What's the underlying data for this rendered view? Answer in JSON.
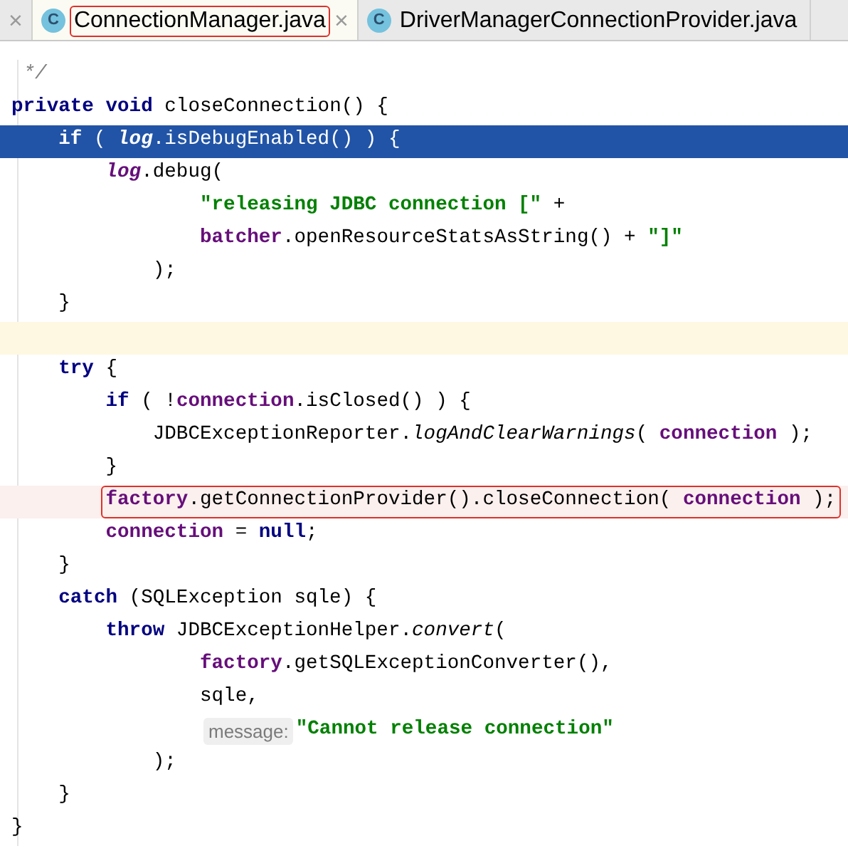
{
  "tabs": [
    {
      "close": "×",
      "selected": false
    },
    {
      "icon_letter": "C",
      "label": "ConnectionManager.java",
      "close": "×",
      "selected": true,
      "marked": true
    },
    {
      "icon_letter": "C",
      "label": "DriverManagerConnectionProvider.java",
      "selected": false,
      "marked": false
    }
  ],
  "lines": [
    {
      "selected": false,
      "current": false,
      "boxed": false,
      "tokens": [
        {
          "kind": "comment",
          "text": " */"
        }
      ]
    },
    {
      "selected": false,
      "current": false,
      "boxed": false,
      "tokens": [
        {
          "kind": "keyword",
          "text": "private"
        },
        {
          "kind": "keyword",
          "text": " void"
        },
        {
          "kind": "plain",
          "text": " closeConnection() {"
        }
      ]
    },
    {
      "selected": true,
      "current": false,
      "boxed": false,
      "tokens": [
        {
          "kind": "keyword",
          "text": "    if"
        },
        {
          "kind": "plain",
          "text": " ( "
        },
        {
          "kind": "static",
          "text": "log"
        },
        {
          "kind": "plain",
          "text": ".isDebugEnabled() ) {"
        }
      ]
    },
    {
      "selected": false,
      "current": false,
      "boxed": false,
      "tokens": [
        {
          "kind": "static",
          "text": "        log"
        },
        {
          "kind": "plain",
          "text": ".debug("
        }
      ]
    },
    {
      "selected": false,
      "current": false,
      "boxed": false,
      "tokens": [
        {
          "kind": "string",
          "text": "                \"releasing JDBC connection [\""
        },
        {
          "kind": "plain",
          "text": " +"
        }
      ]
    },
    {
      "selected": false,
      "current": false,
      "boxed": false,
      "tokens": [
        {
          "kind": "field",
          "text": "                batcher"
        },
        {
          "kind": "plain",
          "text": ".openResourceStatsAsString() + "
        },
        {
          "kind": "string",
          "text": "\"]\""
        }
      ]
    },
    {
      "selected": false,
      "current": false,
      "boxed": false,
      "tokens": [
        {
          "kind": "plain",
          "text": "            );"
        }
      ]
    },
    {
      "selected": false,
      "current": false,
      "boxed": false,
      "tokens": [
        {
          "kind": "plain",
          "text": "    }"
        }
      ]
    },
    {
      "selected": false,
      "current": true,
      "boxed": false
    },
    {
      "selected": false,
      "current": false,
      "boxed": false,
      "tokens": [
        {
          "kind": "keyword",
          "text": "    try"
        },
        {
          "kind": "plain",
          "text": " {"
        }
      ]
    },
    {
      "selected": false,
      "current": false,
      "boxed": false,
      "tokens": [
        {
          "kind": "keyword",
          "text": "        if"
        },
        {
          "kind": "plain",
          "text": " ( !"
        },
        {
          "kind": "field",
          "text": "connection"
        },
        {
          "kind": "plain",
          "text": ".isClosed() ) {"
        }
      ]
    },
    {
      "selected": false,
      "current": false,
      "boxed": false,
      "tokens": [
        {
          "kind": "plain",
          "text": "            JDBCExceptionReporter."
        },
        {
          "kind": "italic",
          "text": "logAndClearWarnings"
        },
        {
          "kind": "plain",
          "text": "( "
        },
        {
          "kind": "field",
          "text": "connection"
        },
        {
          "kind": "plain",
          "text": " );"
        }
      ]
    },
    {
      "selected": false,
      "current": false,
      "boxed": false,
      "tokens": [
        {
          "kind": "plain",
          "text": "        }"
        }
      ]
    },
    {
      "selected": false,
      "current": false,
      "boxed": true,
      "tokens": [
        {
          "kind": "field",
          "text": "        factory"
        },
        {
          "kind": "plain",
          "text": ".getConnectionProvider().closeConnection( "
        },
        {
          "kind": "field",
          "text": "connection"
        },
        {
          "kind": "plain",
          "text": " );"
        }
      ]
    },
    {
      "selected": false,
      "current": false,
      "boxed": false,
      "tokens": [
        {
          "kind": "field",
          "text": "        connection"
        },
        {
          "kind": "plain",
          "text": " = "
        },
        {
          "kind": "keyword",
          "text": "null"
        },
        {
          "kind": "plain",
          "text": ";"
        }
      ]
    },
    {
      "selected": false,
      "current": false,
      "boxed": false,
      "tokens": [
        {
          "kind": "plain",
          "text": "    }"
        }
      ]
    },
    {
      "selected": false,
      "current": false,
      "boxed": false,
      "tokens": [
        {
          "kind": "keyword",
          "text": "    catch"
        },
        {
          "kind": "plain",
          "text": " (SQLException sqle) {"
        }
      ]
    },
    {
      "selected": false,
      "current": false,
      "boxed": false,
      "tokens": [
        {
          "kind": "keyword",
          "text": "        throw"
        },
        {
          "kind": "plain",
          "text": " JDBCExceptionHelper."
        },
        {
          "kind": "italic",
          "text": "convert"
        },
        {
          "kind": "plain",
          "text": "("
        }
      ]
    },
    {
      "selected": false,
      "current": false,
      "boxed": false,
      "tokens": [
        {
          "kind": "field",
          "text": "                factory"
        },
        {
          "kind": "plain",
          "text": ".getSQLExceptionConverter(),"
        }
      ]
    },
    {
      "selected": false,
      "current": false,
      "boxed": false,
      "tokens": [
        {
          "kind": "plain",
          "text": "                sqle,"
        }
      ]
    },
    {
      "selected": false,
      "current": false,
      "boxed": false,
      "tokens": [
        {
          "kind": "hint",
          "text": "                message:"
        },
        {
          "kind": "string",
          "text": "\"Cannot release connection\""
        }
      ]
    },
    {
      "selected": false,
      "current": false,
      "boxed": false,
      "tokens": [
        {
          "kind": "plain",
          "text": "            );"
        }
      ]
    },
    {
      "selected": false,
      "current": false,
      "boxed": false,
      "tokens": [
        {
          "kind": "plain",
          "text": "    }"
        }
      ]
    },
    {
      "selected": false,
      "current": false,
      "boxed": false,
      "tokens": [
        {
          "kind": "plain",
          "text": "}"
        }
      ]
    }
  ]
}
